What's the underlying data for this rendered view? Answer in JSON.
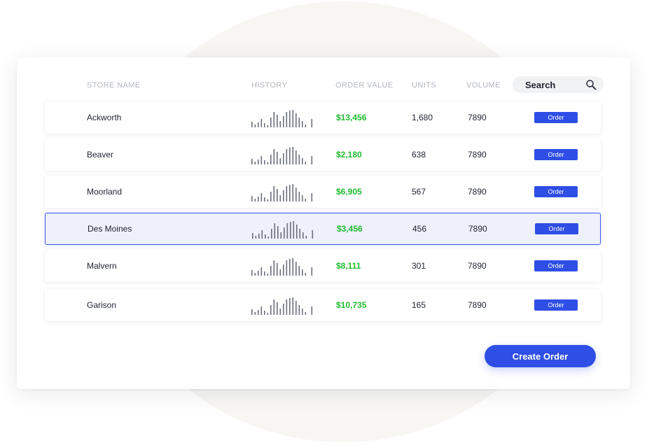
{
  "table": {
    "headers": {
      "store_name": "STORE NAME",
      "history": "HISTORY",
      "order_value": "ORDER VALUE",
      "units": "UNITS",
      "volume": "VOLUME"
    },
    "search": {
      "placeholder": "Search",
      "icon": "search-icon"
    },
    "rows": [
      {
        "store": "Ackworth",
        "order_value": "$13,456",
        "units": "1,680",
        "volume": "7890",
        "action": "Order",
        "selected": false
      },
      {
        "store": "Beaver",
        "order_value": "$2,180",
        "units": "638",
        "volume": "7890",
        "action": "Order",
        "selected": false
      },
      {
        "store": "Moorland",
        "order_value": "$6,905",
        "units": "567",
        "volume": "7890",
        "action": "Order",
        "selected": false
      },
      {
        "store": "Des Moines",
        "order_value": "$3,456",
        "units": "456",
        "volume": "7890",
        "action": "Order",
        "selected": true
      },
      {
        "store": "Malvern",
        "order_value": "$8,111",
        "units": "301",
        "volume": "7890",
        "action": "Order",
        "selected": false
      },
      {
        "store": "Garison",
        "order_value": "$10,735",
        "units": "165",
        "volume": "7890",
        "action": "Order",
        "selected": false
      }
    ]
  },
  "actions": {
    "create_order": "Create Order"
  },
  "colors": {
    "accent": "#2f4ee6",
    "positive_value": "#1fbc2e",
    "selected_row_bg": "#eef0fb",
    "selected_row_border": "#4156f0",
    "header_text": "#b2b5bf",
    "sparkline": "#6b6f7d"
  }
}
